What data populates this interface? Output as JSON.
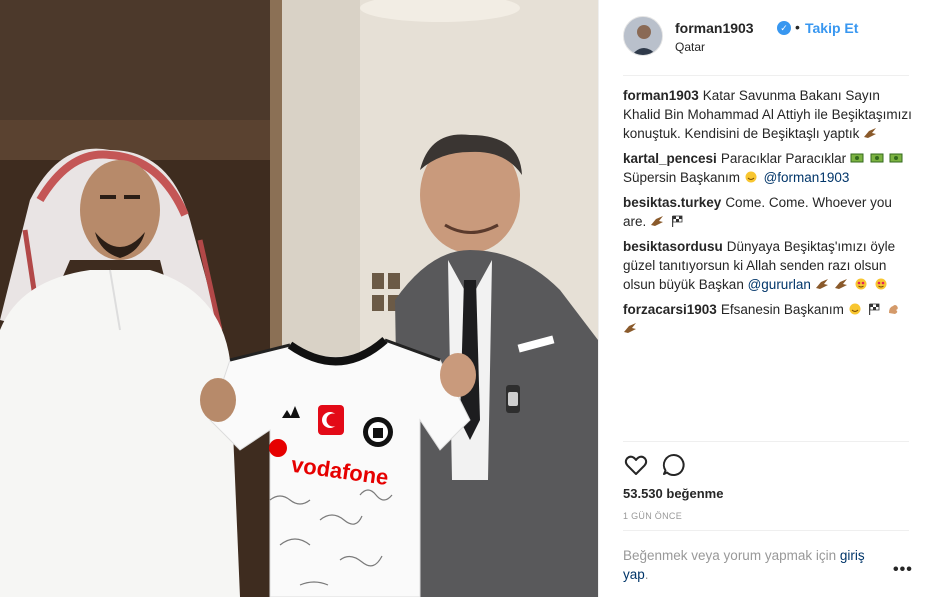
{
  "post": {
    "username": "forman1903",
    "follow_label": "Takip Et",
    "separator": "•",
    "location": "Qatar",
    "verified_icon": "✓"
  },
  "comments": [
    {
      "user": "forman1903",
      "text": "Katar Savunma Bakanı Sayın Khalid Bin Mohammad Al Attiyh ile Beşiktaşımızı konuştuk. Kendisini de Beşiktaşlı yaptık",
      "emojis": [
        "eagle-icon"
      ]
    },
    {
      "user": "kartal_pencesi",
      "text": "Paracıklar Paracıklar",
      "emojis": [
        "money-icon",
        "money-icon",
        "money-icon"
      ],
      "text2": "Süpersin Başkanım",
      "emojis2": [
        "smile-icon"
      ],
      "mention": "@forman1903"
    },
    {
      "user": "besiktas.turkey",
      "text": "Come. Come. Whoever you are.",
      "emojis": [
        "eagle-icon",
        "flag-icon"
      ]
    },
    {
      "user": "besiktasordusu",
      "text": "Dünyaya Beşiktaş'ımızı öyle güzel tanıtıyorsun ki Allah senden razı olsun olsun büyük Başkan",
      "mention": "@gururlan",
      "emojis": [
        "eagle-icon",
        "eagle-icon",
        "heart-eyes-icon",
        "heart-eyes-icon"
      ]
    },
    {
      "user": "forzacarsi1903",
      "text": "Efsanesin Başkanım",
      "emojis": [
        "smile-icon",
        "flag-icon",
        "muscle-icon",
        "eagle-icon"
      ]
    }
  ],
  "likes": "53.530 beğenme",
  "time": "1 GÜN ÖNCE",
  "login": {
    "prefix": "Beğenmek veya yorum yapmak için",
    "link": "giriş yap",
    "suffix": "."
  },
  "more_label": "•••",
  "colors": {
    "link": "#003569",
    "accent": "#3897f0",
    "muted": "#999999",
    "text": "#262626"
  }
}
